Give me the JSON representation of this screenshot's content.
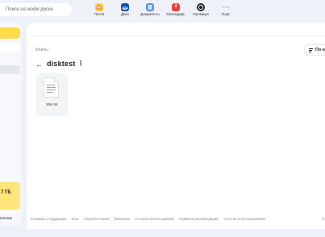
{
  "header": {
    "search_placeholder": "Поиск на моём диске",
    "apps": [
      {
        "label": "Почта",
        "icon": "mail-icon",
        "color": "#ff9a3d"
      },
      {
        "label": "Диск",
        "icon": "disk-icon",
        "color": "#1f6fd6"
      },
      {
        "label": "Документы",
        "icon": "documents-icon",
        "color": "#5b8def"
      },
      {
        "label": "Календарь",
        "icon": "calendar-icon",
        "color": "#f43a3a",
        "badge": "2"
      },
      {
        "label": "Премиум",
        "icon": "premium-icon",
        "color": "#1f1f1f"
      },
      {
        "label": "Ещё",
        "icon": "more-apps-icon",
        "color": "#9aa0a6"
      }
    ]
  },
  "sidebar": {
    "quota_label": "7 ГБ",
    "bottom_link": "вление"
  },
  "main": {
    "breadcrumb": "Файлы",
    "folder_title": "disktest",
    "sort_label": "По н",
    "files": [
      {
        "name": "99x.txt",
        "icon": "text-file-icon"
      }
    ]
  },
  "footer": {
    "links": [
      "Справка и поддержка",
      "Блог",
      "Разработчикам",
      "Вакансии",
      "Условия использования",
      "Правила рекомендаций",
      "Участие в исследованиях"
    ],
    "copyright": "© Я"
  },
  "colors": {
    "accent_yellow": "#ffdb4d",
    "quota_yellow": "#ffe57a",
    "background": "#eef2f8"
  }
}
